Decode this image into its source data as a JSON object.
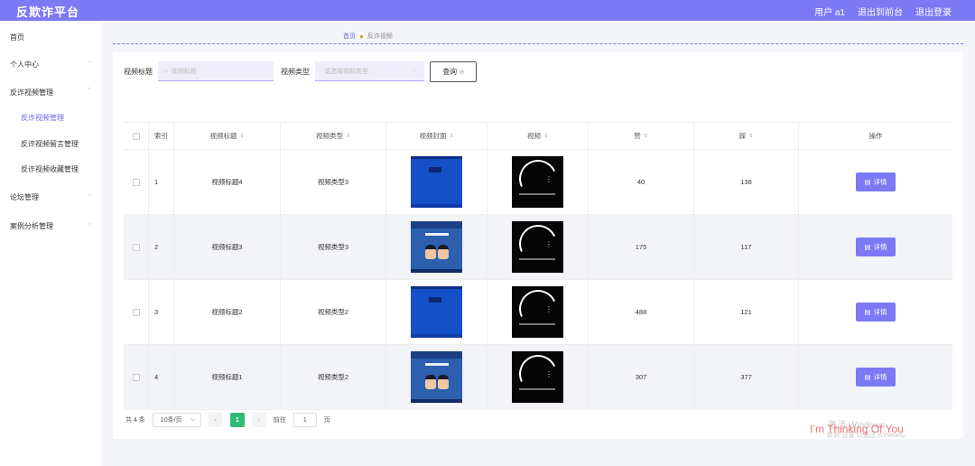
{
  "header": {
    "brand": "反欺诈平台",
    "user": "用户 a1",
    "back_front": "退出到前台",
    "logout": "退出登录"
  },
  "sidebar": {
    "items": [
      {
        "label": "首页"
      },
      {
        "label": "个人中心"
      },
      {
        "label": "反诈视频管理"
      },
      {
        "label": "反诈视频管理"
      },
      {
        "label": "反诈视频留言管理"
      },
      {
        "label": "反诈视频收藏管理"
      },
      {
        "label": "论坛管理"
      },
      {
        "label": "案例分析管理"
      }
    ]
  },
  "breadcrumb": {
    "home": "首页",
    "current": "反诈视频"
  },
  "search": {
    "title_label": "视频标题",
    "title_placeholder": "视频标题",
    "type_label": "视频类型",
    "type_placeholder": "请选择视频类型",
    "query_label": "查询"
  },
  "table": {
    "headers": {
      "index": "索引",
      "title": "视频标题",
      "type": "视频类型",
      "cover": "视频封面",
      "video": "视频",
      "like": "赞",
      "dislike": "踩",
      "op": "操作"
    },
    "rows": [
      {
        "index": "1",
        "title": "视频标题4",
        "type": "视频类型3",
        "like": "40",
        "dislike": "138",
        "cover": "blue-screen"
      },
      {
        "index": "2",
        "title": "视频标题3",
        "type": "视频类型3",
        "like": "175",
        "dislike": "117",
        "cover": "poster"
      },
      {
        "index": "3",
        "title": "视频标题2",
        "type": "视频类型2",
        "like": "488",
        "dislike": "121",
        "cover": "blue-screen"
      },
      {
        "index": "4",
        "title": "视频标题1",
        "type": "视频类型2",
        "like": "307",
        "dislike": "377",
        "cover": "poster"
      }
    ],
    "detail_label": "详情"
  },
  "pager": {
    "total": "共 4 条",
    "page_size": "10条/页",
    "current_page": "1",
    "goto_label": "前往",
    "goto_value": "1",
    "page_suffix": "页"
  },
  "watermark": {
    "line1": "激活 Windows",
    "line2": "转到\"设置\"以激活 Windows。",
    "overlay": "I’m Thinking Of You"
  },
  "colors": {
    "accent": "#7b79f3",
    "pager_active": "#2dbd7a"
  }
}
